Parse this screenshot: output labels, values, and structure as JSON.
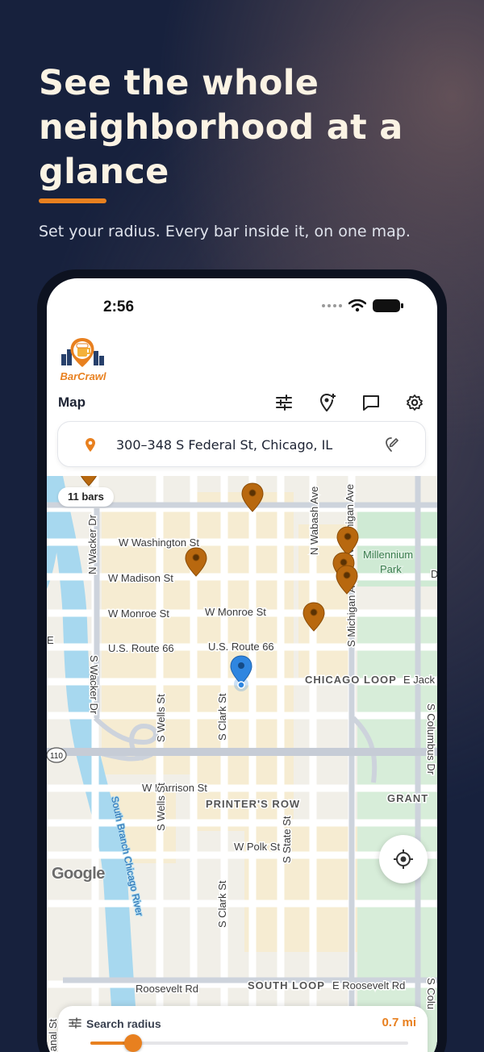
{
  "hero": {
    "headline": "See the whole neighborhood at a glance",
    "subhead": "Set your radius. Every bar inside it, on one map."
  },
  "status_bar": {
    "time": "2:56"
  },
  "app": {
    "logo_text": "BarCrawl",
    "title": "Map",
    "toolbar_icons": [
      "filter-icon",
      "add-location-icon",
      "chat-icon",
      "gear-icon"
    ]
  },
  "search": {
    "address": "300–348 S Federal St, Chicago, IL"
  },
  "map": {
    "bars_count_label": "11 bars",
    "attribution": "Google",
    "labels": {
      "washington": "W Washington St",
      "madison": "W Madison St",
      "monroe_w": "W Monroe St",
      "monroe_e": "W Monroe St",
      "route66_w": "U.S. Route 66",
      "route66_e": "U.S. Route 66",
      "chicago_loop": "CHICAGO LOOP",
      "e_jack": "E Jack",
      "harrison": "W Harrison St",
      "printers_row": "PRINTER'S ROW",
      "polk": "W Polk St",
      "roosevelt_w": "Roosevelt Rd",
      "south_loop": "SOUTH LOOP",
      "roosevelt_e": "E Roosevelt Rd",
      "grant": "GRANT",
      "millennium": "Millennium",
      "park": "Park",
      "wacker_n": "N Wacker Dr",
      "wacker_s": "S Wacker Dr",
      "wells_1": "S Wells St",
      "wells_2": "S Wells St",
      "clark_1": "S Clark St",
      "clark_2": "S Clark St",
      "state": "S State St",
      "wabash": "N Wabash Ave",
      "michigan_n": "N Michigan Ave",
      "michigan_s": "S Michigan Ave",
      "columbus": "S Columbus Dr",
      "canal": "S Canal St",
      "river": "South Branch Chicago River",
      "route110": "110",
      "d_letter": "D",
      "e_letter": "E",
      "co_letter": "S Colu"
    }
  },
  "radius": {
    "label": "Search radius",
    "value_label": "0.7 mi",
    "fraction": 0.1
  },
  "colors": {
    "accent": "#e8801f",
    "pin_bar": "#b8680f",
    "pin_user": "#2f86e0",
    "background": "#17213d"
  }
}
